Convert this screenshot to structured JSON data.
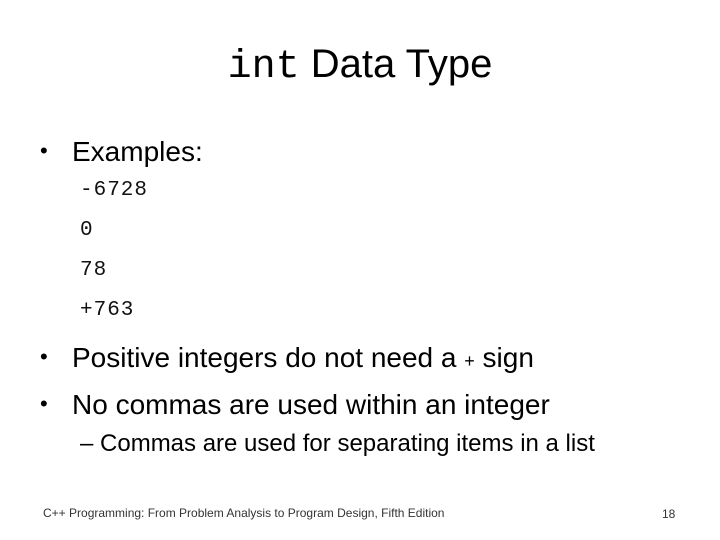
{
  "slide": {
    "title": {
      "code_part": "int",
      "text_part": " Data Type"
    },
    "bullets": [
      {
        "label": "Examples:"
      },
      {
        "before": "Positive integers do not need a ",
        "symbol": "+",
        "after": " sign"
      },
      {
        "label": "No commas are used within an integer"
      }
    ],
    "examples": [
      "-6728",
      "0",
      "78",
      "+763"
    ],
    "sub_bullet": "– Commas are used for separating items in a list",
    "bullet_glyph": "•",
    "footer": "C++ Programming: From Problem Analysis to Program Design, Fifth Edition",
    "page_number": "18"
  }
}
